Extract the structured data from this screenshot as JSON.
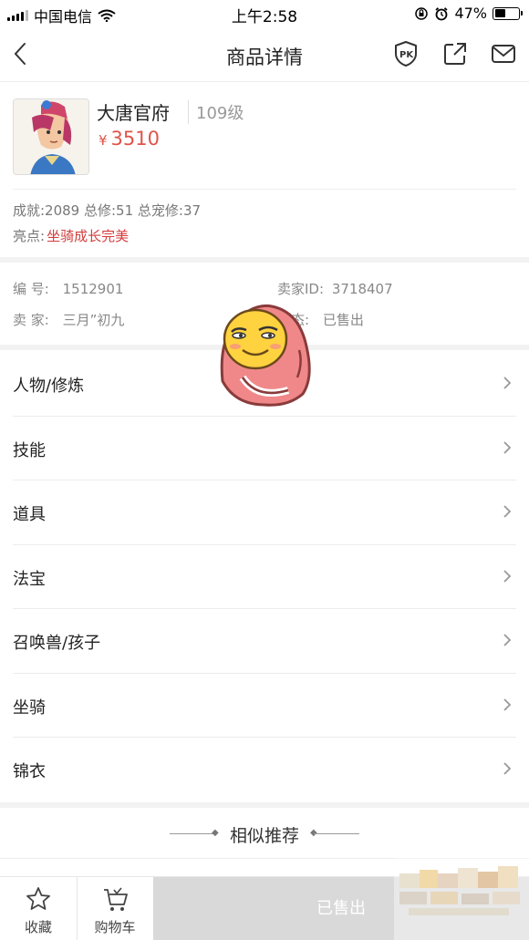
{
  "status_bar": {
    "carrier": "中国电信",
    "time": "上午2:58",
    "battery_percent": "47%",
    "battery_level": 0.47
  },
  "nav": {
    "title": "商品详情",
    "icons": [
      "back-arrow-icon",
      "pk-icon",
      "share-icon",
      "mail-icon"
    ]
  },
  "product": {
    "name": "大唐官府",
    "level": "109级",
    "price_symbol": "¥",
    "price": "3510",
    "stats": "成就:2089 总修:51 总宠修:37",
    "highlight_label": "亮点:",
    "highlight_value": "坐骑成长完美"
  },
  "info": {
    "id_label": "编 号:",
    "id_value": "1512901",
    "seller_id_label": "卖家ID:",
    "seller_id_value": "3718407",
    "seller_label": "卖 家:",
    "seller_value": "三月”初九",
    "status_label": "状态:",
    "status_value": "已售出"
  },
  "sections": [
    {
      "label": "人物/修炼"
    },
    {
      "label": "技能"
    },
    {
      "label": "道具"
    },
    {
      "label": "法宝"
    },
    {
      "label": "召唤兽/孩子"
    },
    {
      "label": "坐骑"
    },
    {
      "label": "锦衣"
    }
  ],
  "similar_title": "相似推荐",
  "bottom_bar": {
    "favorite_label": "收藏",
    "cart_label": "购物车",
    "sold_label": "已售出"
  },
  "colors": {
    "price": "#e0534a",
    "highlight": "#d43c3c",
    "sold_button": "#d9d9d9"
  }
}
